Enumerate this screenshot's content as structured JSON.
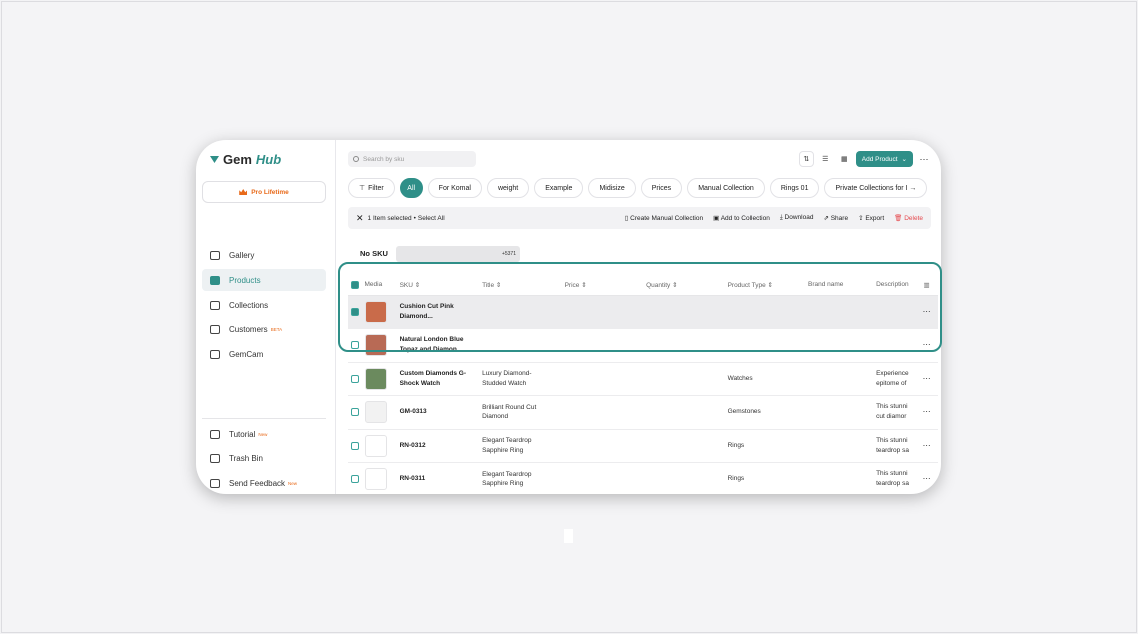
{
  "app": {
    "logo_gem": "Gem",
    "logo_hub": "Hub",
    "pro_label": "Pro Lifetime"
  },
  "sidebar": {
    "items": [
      {
        "label": "Gallery",
        "icon": "gallery-icon"
      },
      {
        "label": "Products",
        "icon": "products-icon",
        "active": true
      },
      {
        "label": "Collections",
        "icon": "collections-icon"
      },
      {
        "label": "Customers",
        "icon": "customers-icon",
        "badge": "BETA"
      },
      {
        "label": "GemCam",
        "icon": "camera-icon"
      }
    ],
    "bottom": [
      {
        "label": "Tutorial",
        "icon": "tutorial-icon",
        "badge": "New"
      },
      {
        "label": "Trash Bin",
        "icon": "trash-icon"
      },
      {
        "label": "Send Feedback",
        "icon": "feedback-icon",
        "badge": "New"
      }
    ]
  },
  "search": {
    "placeholder": "Search by sku"
  },
  "toolbar": {
    "add_product": "Add Product"
  },
  "tabs": {
    "filter": "Filter",
    "items": [
      "All",
      "For Komal",
      "weight",
      "Example",
      "Midisize",
      "Prices",
      "Manual Collection",
      "Rings 01",
      "Private Collections for I →"
    ]
  },
  "selection": {
    "count": "1 Item selected",
    "select_all": "Select All",
    "create_collection": "Create Manual Collection",
    "add_collection": "Add to Collection",
    "download": "Download",
    "share": "Share",
    "export": "Export",
    "delete": "Delete"
  },
  "nosku": {
    "label": "No SKU",
    "extra": "+5371"
  },
  "table": {
    "columns": [
      "Media",
      "SKU",
      "Title",
      "Price",
      "Quantity",
      "Product Type",
      "Brand name",
      "Description"
    ],
    "rows": [
      {
        "sku": "Cushion Cut Pink Diamond...",
        "title": "",
        "type": "",
        "desc": "",
        "checked": true,
        "media_color": "#c96b4a"
      },
      {
        "sku": "Natural London Blue Topaz and Diamon...",
        "title": "",
        "type": "",
        "desc": "",
        "checked": false,
        "media_color": "#b86a55"
      },
      {
        "sku": "Custom Diamonds G-Shock Watch",
        "title": "Luxury Diamond-Studded Watch",
        "type": "Watches",
        "desc": "Experience epitome of",
        "checked": false,
        "media_color": "#6b8a5e"
      },
      {
        "sku": "GM-0313",
        "title": "Brilliant Round Cut Diamond",
        "type": "Gemstones",
        "desc": "This stunni cut diamor",
        "checked": false,
        "media_color": "#f2f2f2"
      },
      {
        "sku": "RN-0312",
        "title": "Elegant Teardrop Sapphire Ring",
        "type": "Rings",
        "desc": "This stunni teardrop sa",
        "checked": false,
        "media_color": "#ffffff"
      },
      {
        "sku": "RN-0311",
        "title": "Elegant Teardrop Sapphire Ring",
        "type": "Rings",
        "desc": "This stunni teardrop sa",
        "checked": false,
        "media_color": "#ffffff"
      }
    ]
  },
  "colors": {
    "accent": "#2f8f88",
    "danger": "#e5484d",
    "pro": "#e86a1a"
  }
}
